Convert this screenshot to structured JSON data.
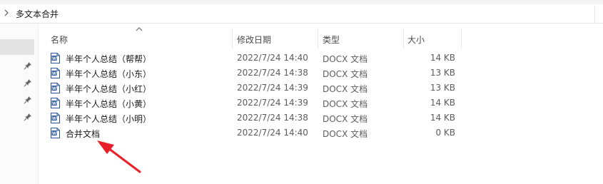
{
  "breadcrumb": {
    "folder": "多文本合并"
  },
  "columns": {
    "name": "名称",
    "date": "修改日期",
    "type": "类型",
    "size": "大小"
  },
  "files": [
    {
      "name": "半年个人总结（帮帮）",
      "date": "2022/7/24 14:40",
      "type": "DOCX 文档",
      "size": "14 KB"
    },
    {
      "name": "半年个人总结（小东）",
      "date": "2022/7/24 14:38",
      "type": "DOCX 文档",
      "size": "13 KB"
    },
    {
      "name": "半年个人总结（小红）",
      "date": "2022/7/24 14:39",
      "type": "DOCX 文档",
      "size": "13 KB"
    },
    {
      "name": "半年个人总结（小黄）",
      "date": "2022/7/24 14:39",
      "type": "DOCX 文档",
      "size": "14 KB"
    },
    {
      "name": "半年个人总结（小明）",
      "date": "2022/7/24 14:38",
      "type": "DOCX 文档",
      "size": "14 KB"
    },
    {
      "name": "合并文档",
      "date": "2022/7/24 14:40",
      "type": "DOCX 文档",
      "size": "0 KB"
    }
  ],
  "icons": {
    "file": "word-document-icon",
    "pin": "pin-icon",
    "sort": "sort-ascending-icon"
  },
  "colors": {
    "word_blue": "#2b579a",
    "annotation_arrow": "#e8202a"
  }
}
